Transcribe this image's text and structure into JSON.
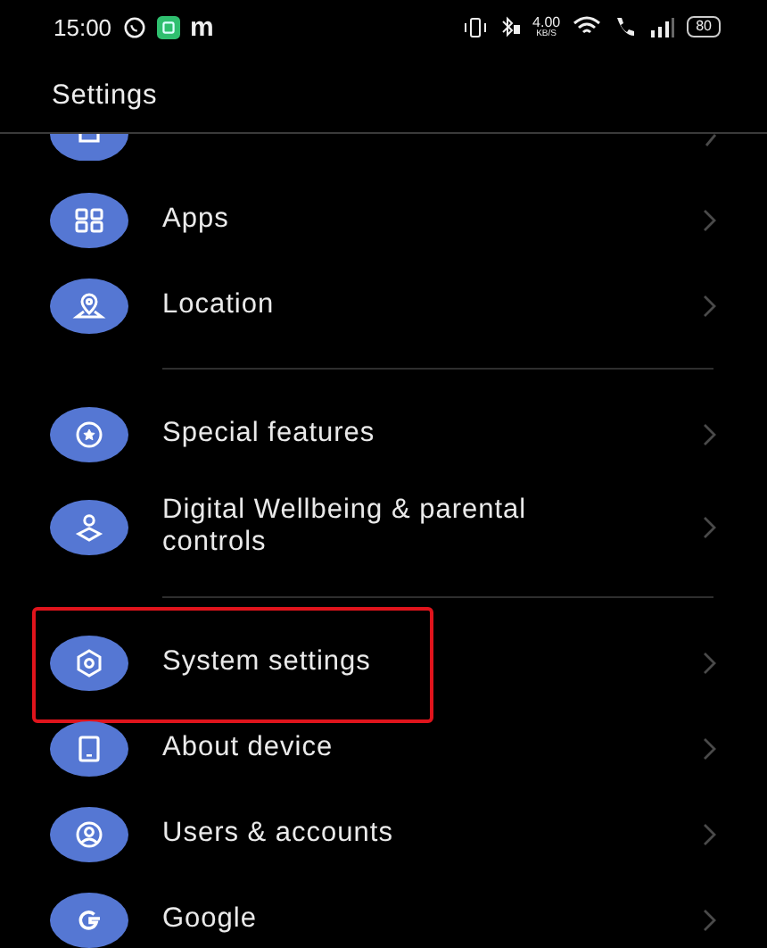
{
  "status_bar": {
    "time": "15:00",
    "app_letter": "m",
    "speed": "4.00",
    "speed_unit": "KB/S",
    "battery": "80"
  },
  "header": {
    "title": "Settings"
  },
  "sections": [
    {
      "items": [
        {
          "kind": "partial"
        },
        {
          "kind": "item",
          "label": "Apps",
          "highlighted": false
        },
        {
          "kind": "item",
          "label": "Location",
          "highlighted": false
        }
      ]
    },
    {
      "items": [
        {
          "kind": "item",
          "label": "Special features",
          "highlighted": false
        },
        {
          "kind": "item",
          "label": "Digital Wellbeing & parental controls",
          "highlighted": false
        }
      ]
    },
    {
      "items": [
        {
          "kind": "item",
          "label": "System settings",
          "highlighted": true
        },
        {
          "kind": "item",
          "label": "About device",
          "highlighted": false
        },
        {
          "kind": "item",
          "label": "Users & accounts",
          "highlighted": false
        },
        {
          "kind": "item",
          "label": "Google",
          "highlighted": false
        }
      ]
    }
  ]
}
